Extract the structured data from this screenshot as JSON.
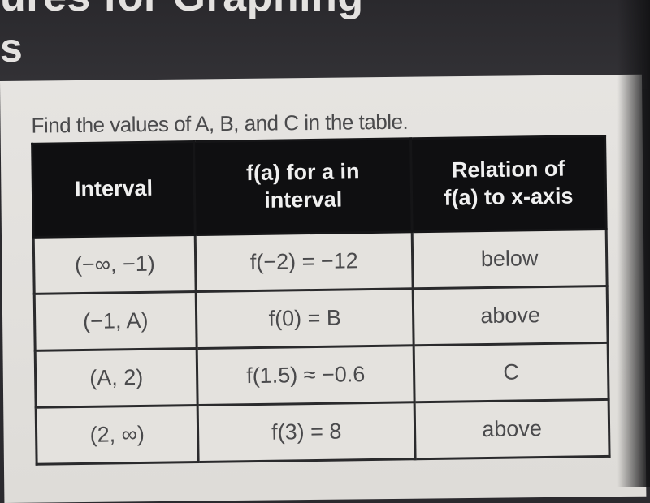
{
  "header": {
    "title_line1": "ures for Graphing",
    "title_line2": "s"
  },
  "prompt": "Find the values of A, B, and C in the table.",
  "table": {
    "headers": [
      {
        "line1": "Interval",
        "line2": ""
      },
      {
        "line1": "f(a) for a in",
        "line2": "interval"
      },
      {
        "line1": "Relation of",
        "line2": "f(a) to x-axis"
      }
    ],
    "rows": [
      {
        "interval": "(−∞, −1)",
        "value": "f(−2) = −12",
        "relation": "below"
      },
      {
        "interval": "(−1, A)",
        "value": "f(0) = B",
        "relation": "above"
      },
      {
        "interval": "(A, 2)",
        "value": "f(1.5) ≈ −0.6",
        "relation": "C"
      },
      {
        "interval": "(2, ∞)",
        "value": "f(3) = 8",
        "relation": "above"
      }
    ]
  }
}
